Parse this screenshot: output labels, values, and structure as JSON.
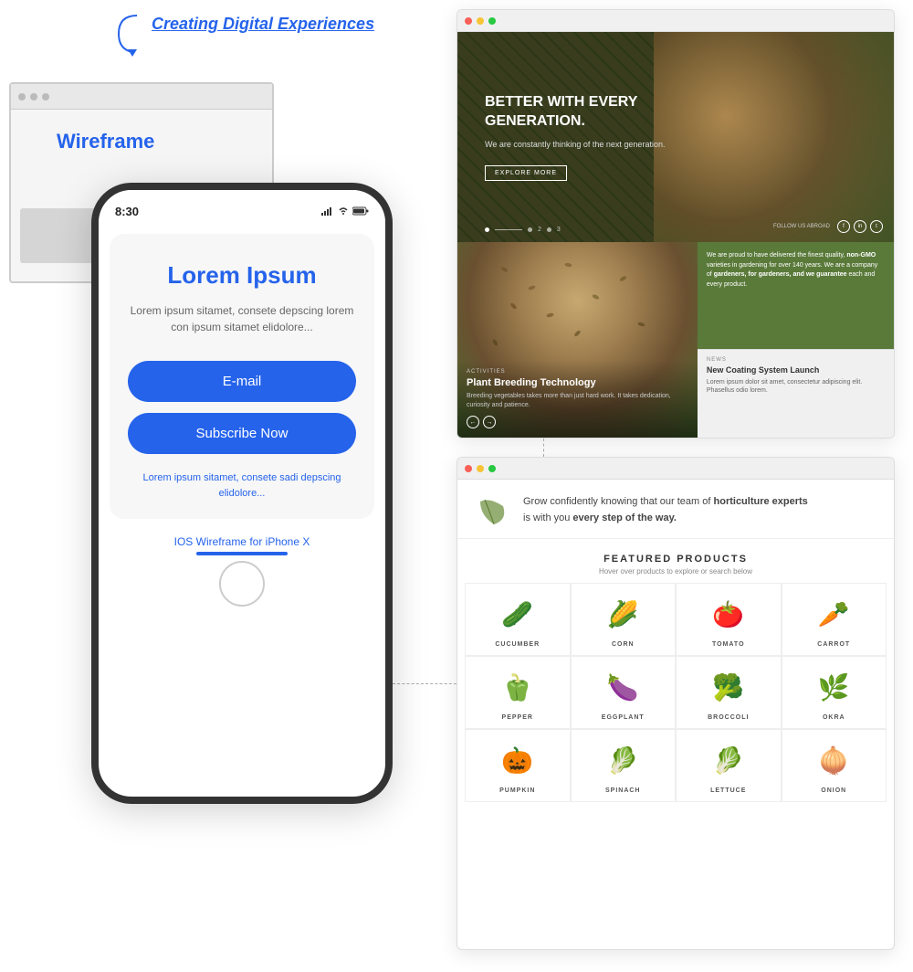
{
  "top_label": {
    "text": "Creating Digital Experiences"
  },
  "wireframe": {
    "title": "Wireframe"
  },
  "iphone": {
    "time": "8:30",
    "lorem_title": "Lorem Ipsum",
    "lorem_sub": "Lorem ipsum sitamet, consete depscing lorem con ipsum sitamet elidolore...",
    "email_placeholder": "E-mail",
    "subscribe_btn": "Subscribe Now",
    "footer_text": "Lorem ipsum sitamet, consete\nsadi depscing elidolore...",
    "bottom_label": "IOS Wireframe for iPhone X"
  },
  "browser1": {
    "hero": {
      "title": "BETTER WITH EVERY GENERATION.",
      "sub": "We are constantly thinking of the next generation.",
      "btn_label": "EXPLORE MORE",
      "dots": [
        "1",
        "2",
        "3"
      ],
      "social_label": "FOLLOW US ABROAD"
    },
    "activities": {
      "label": "ACTIVITIES",
      "title": "Plant Breeding Technology",
      "sub": "Breeding vegetables takes more than just hard work. It takes dedication, curiosity and patience.",
      "arrow_prev": "←",
      "arrow_next": "→"
    },
    "green_panel": {
      "text": "We are proud to have delivered the finest quality, non-GMO varieties in gardening for over 140 years. We are a company of gardeners, for gardeners, and we guarantee each and every product."
    },
    "news_panel": {
      "label": "NEWS",
      "title": "New Coating System Launch",
      "sub": "Lorem ipsum dolor sit amet, consectetur adipiscing elit. Phasellus odio lorem."
    }
  },
  "browser2": {
    "header_text": "Grow confidently knowing that our team of horticulture experts is with you every step of the way.",
    "featured": {
      "title": "FEATURED PRODUCTS",
      "sub": "Hover over products to explore or search below"
    },
    "products": [
      {
        "name": "CUCUMBER",
        "emoji": "🥒"
      },
      {
        "name": "CORN",
        "emoji": "🌽"
      },
      {
        "name": "TOMATO",
        "emoji": "🍅"
      },
      {
        "name": "CARROT",
        "emoji": "🥕"
      },
      {
        "name": "PEPPER",
        "emoji": "🫑"
      },
      {
        "name": "EGGPLANT",
        "emoji": "🍆"
      },
      {
        "name": "BROCCOLI",
        "emoji": "🥦"
      },
      {
        "name": "OKRA",
        "emoji": "🌿"
      },
      {
        "name": "PUMPKIN",
        "emoji": "🎃"
      },
      {
        "name": "SPINACH",
        "emoji": "🥬"
      },
      {
        "name": "LETTUCE",
        "emoji": "🥬"
      },
      {
        "name": "ONION",
        "emoji": "🧅"
      }
    ]
  },
  "colors": {
    "blue": "#2563eb",
    "green": "#5a7a3a",
    "dark": "#333"
  }
}
